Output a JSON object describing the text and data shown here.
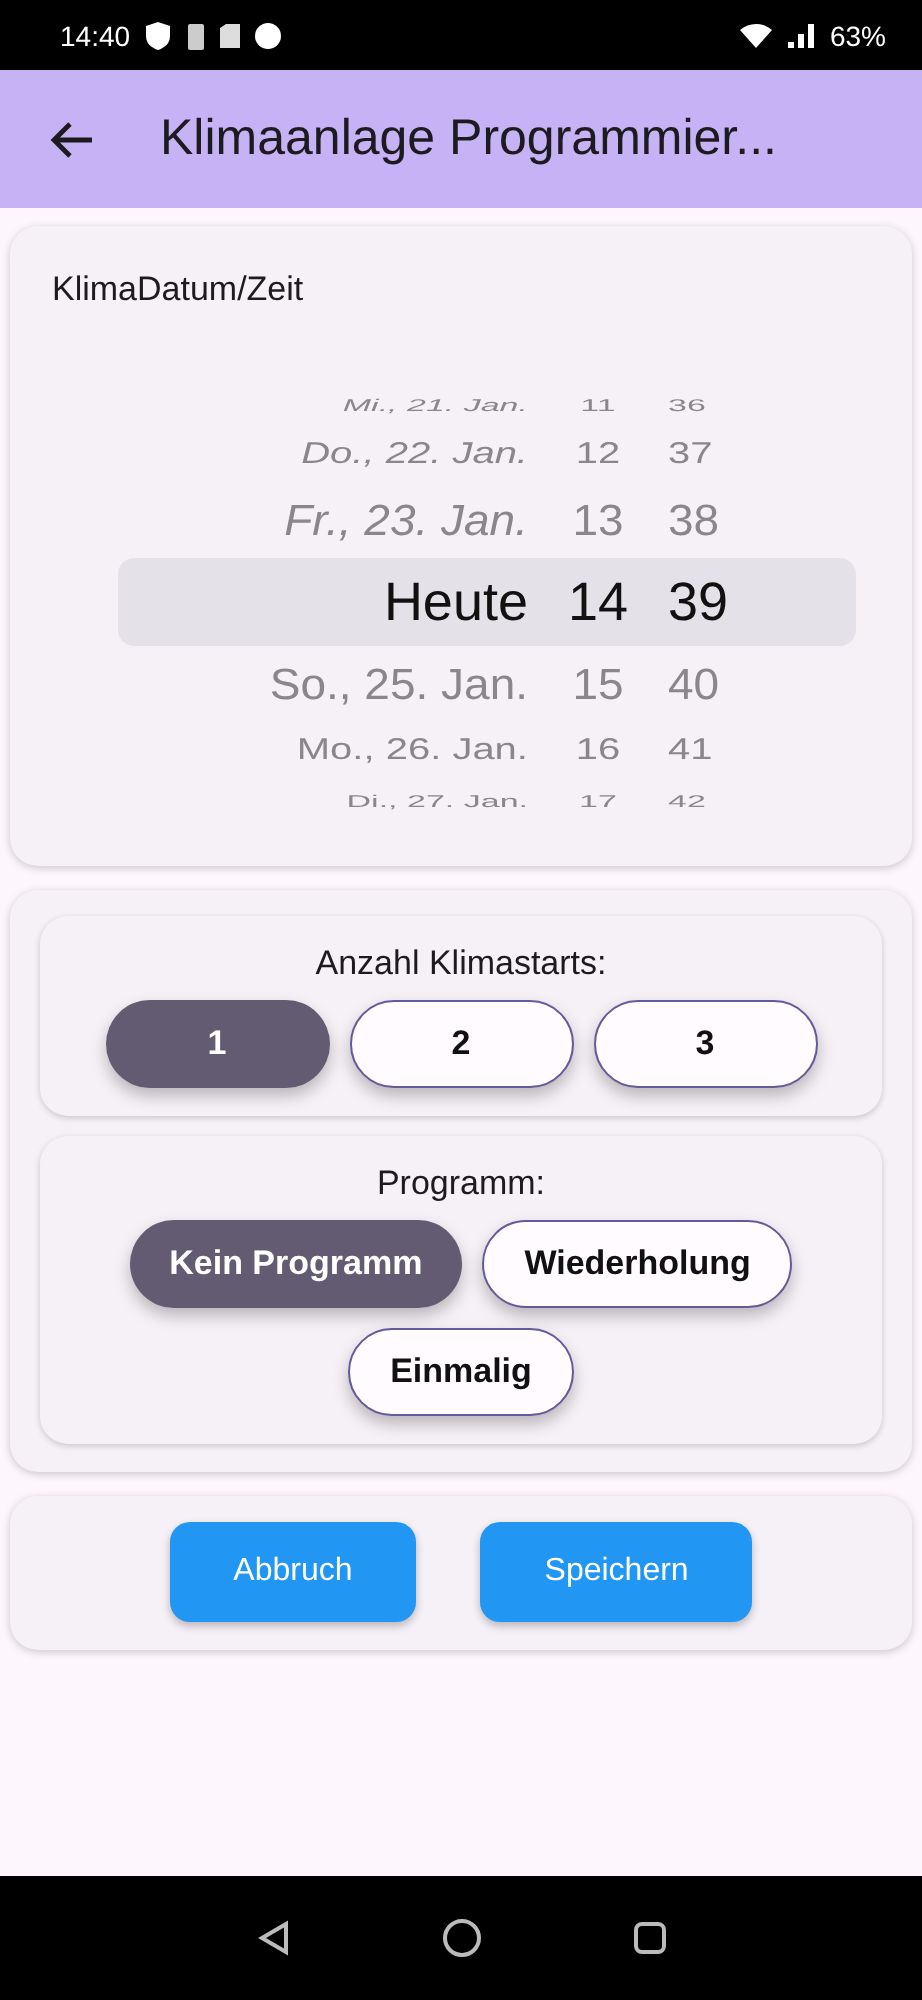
{
  "status_bar": {
    "time": "14:40",
    "battery": "63%"
  },
  "app_bar": {
    "title": "Klimaanlage Programmier..."
  },
  "date_card": {
    "label": "KlimaDatum/Zeit",
    "picker_rows": [
      {
        "date": "Mi., 21. Jan.",
        "hour": "11",
        "minute": "36",
        "selected": false
      },
      {
        "date": "Do., 22. Jan.",
        "hour": "12",
        "minute": "37",
        "selected": false
      },
      {
        "date": "Fr., 23. Jan.",
        "hour": "13",
        "minute": "38",
        "selected": false
      },
      {
        "date": "Heute",
        "hour": "14",
        "minute": "39",
        "selected": true
      },
      {
        "date": "So., 25. Jan.",
        "hour": "15",
        "minute": "40",
        "selected": false
      },
      {
        "date": "Mo., 26. Jan.",
        "hour": "16",
        "minute": "41",
        "selected": false
      },
      {
        "date": "Di., 27. Jan.",
        "hour": "17",
        "minute": "42",
        "selected": false
      }
    ]
  },
  "starts": {
    "label": "Anzahl Klimastarts:",
    "options": [
      {
        "label": "1",
        "selected": true
      },
      {
        "label": "2",
        "selected": false
      },
      {
        "label": "3",
        "selected": false
      }
    ]
  },
  "program": {
    "label": "Programm:",
    "options": [
      {
        "label": "Kein Programm",
        "selected": true
      },
      {
        "label": "Wiederholung",
        "selected": false
      },
      {
        "label": "Einmalig",
        "selected": false
      }
    ]
  },
  "buttons": [
    "Abbruch",
    "Speichern"
  ]
}
